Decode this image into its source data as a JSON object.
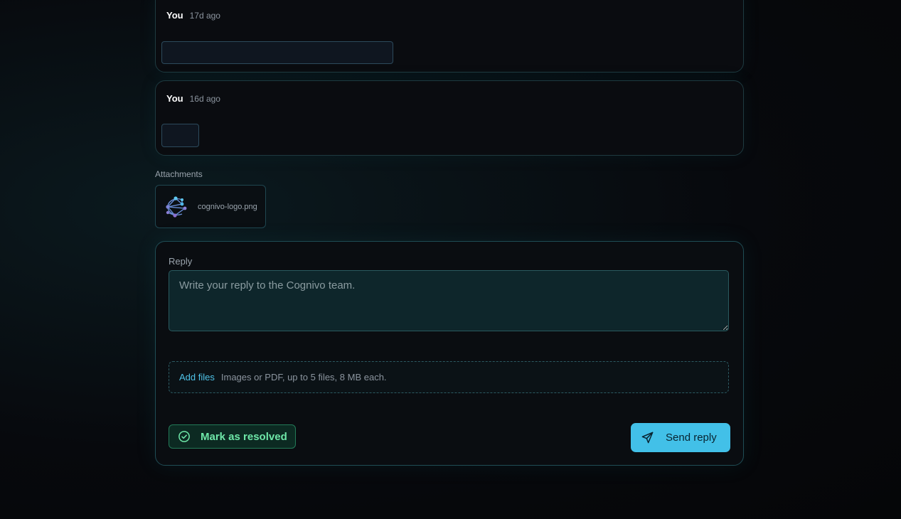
{
  "messages": [
    {
      "author": "You",
      "time": "17d ago"
    },
    {
      "author": "You",
      "time": "16d ago"
    }
  ],
  "attachments": {
    "label": "Attachments",
    "files": [
      {
        "name": "cognivo-logo.png",
        "icon": "cognivo-logo"
      }
    ]
  },
  "reply": {
    "label": "Reply",
    "placeholder": "Write your reply to the Cognivo team.",
    "add_files": "Add files",
    "file_hint": "Images or PDF, up to 5 files, 8 MB each.",
    "resolve_label": "Mark as resolved",
    "send_label": "Send reply"
  },
  "colors": {
    "accent": "#42c0e8",
    "resolve": "#6ee7a8",
    "background": "#07090d"
  },
  "icons": {
    "resolve": "check-circle-icon",
    "send": "paper-plane-icon"
  }
}
